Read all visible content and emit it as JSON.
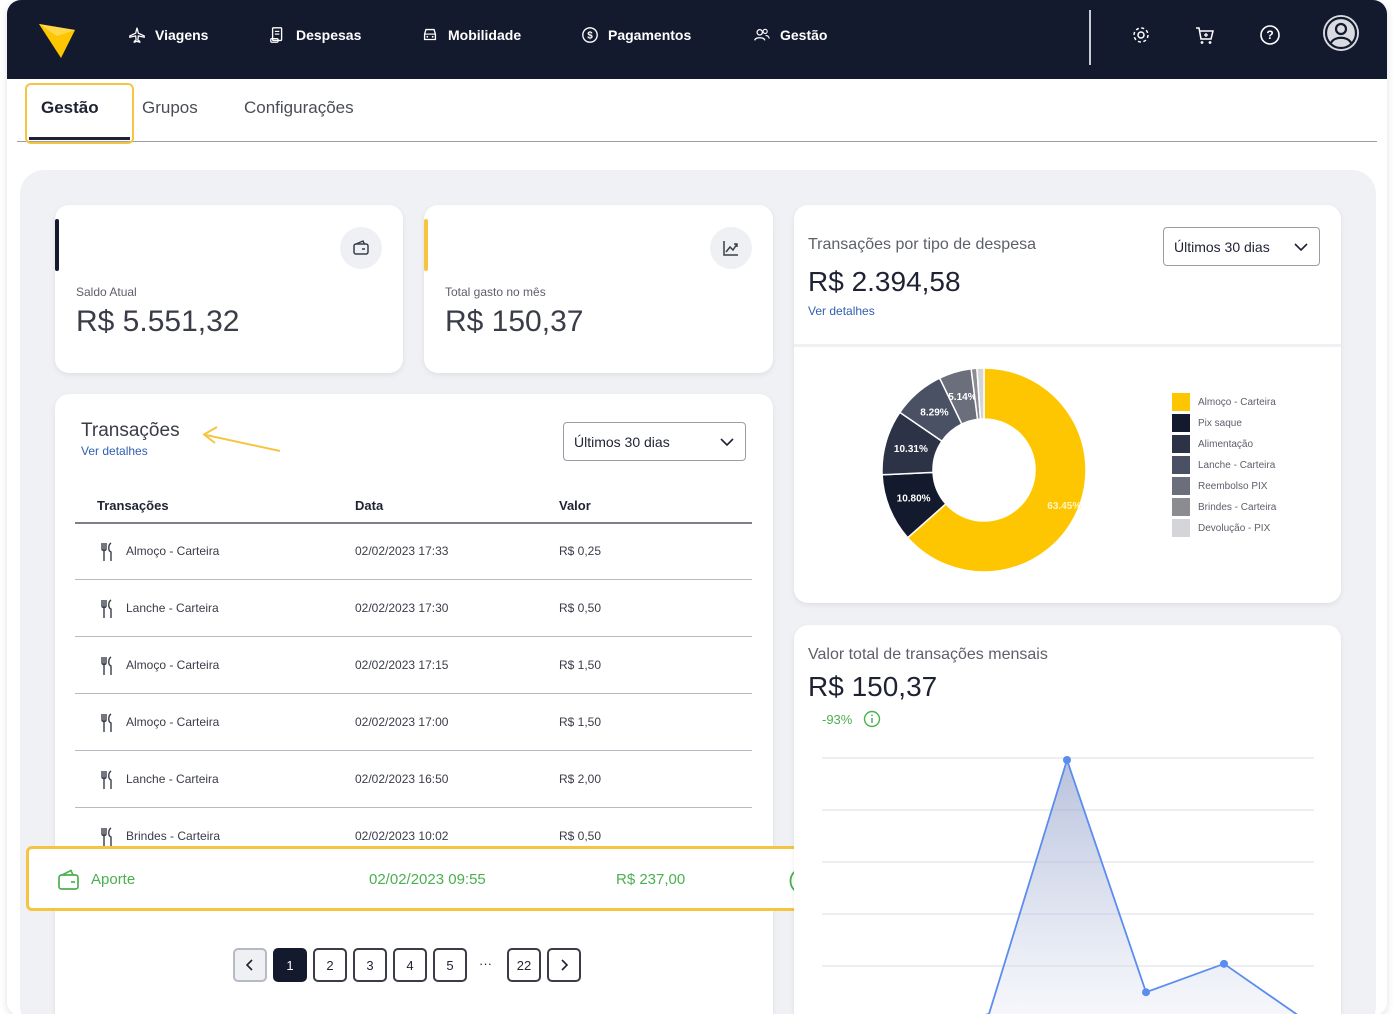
{
  "nav": {
    "items": [
      {
        "label": "Viagens",
        "icon": "plane-icon"
      },
      {
        "label": "Despesas",
        "icon": "receipt-icon"
      },
      {
        "label": "Mobilidade",
        "icon": "car-icon"
      },
      {
        "label": "Pagamentos",
        "icon": "dollar-icon"
      },
      {
        "label": "Gestão",
        "icon": "users-icon"
      }
    ],
    "right_icons": [
      "gear-icon",
      "cart-icon",
      "help-icon",
      "avatar-icon"
    ]
  },
  "tabs": [
    "Gestão",
    "Grupos",
    "Configurações"
  ],
  "kpis": [
    {
      "label": "Saldo Atual",
      "value": "R$ 5.551,32",
      "accent": "#141a2e",
      "icon": "wallet-icon"
    },
    {
      "label": "Total gasto no mês",
      "value": "R$ 150,37",
      "accent": "#f5c542",
      "icon": "trend-chart-icon"
    }
  ],
  "transactions": {
    "title": "Transações",
    "link": "Ver detalhes",
    "filter": "Últimos 30 dias",
    "columns": [
      "Transações",
      "Data",
      "Valor"
    ],
    "rows": [
      {
        "name": "Almoço - Carteira",
        "date": "02/02/2023 17:33",
        "value": "R$ 0,25"
      },
      {
        "name": "Lanche - Carteira",
        "date": "02/02/2023 17:30",
        "value": "R$ 0,50"
      },
      {
        "name": "Almoço - Carteira",
        "date": "02/02/2023 17:15",
        "value": "R$ 1,50"
      },
      {
        "name": "Almoço - Carteira",
        "date": "02/02/2023 17:00",
        "value": "R$ 1,50"
      },
      {
        "name": "Lanche - Carteira",
        "date": "02/02/2023 16:50",
        "value": "R$ 2,00"
      },
      {
        "name": "Brindes - Carteira",
        "date": "02/02/2023 10:02",
        "value": "R$ 0,50"
      }
    ],
    "highlight": {
      "name": "Aporte",
      "date": "02/02/2023 09:55",
      "value": "R$ 237,00"
    },
    "pager": {
      "pages": [
        "1",
        "2",
        "3",
        "4",
        "5"
      ],
      "ellipsis": "···",
      "last": "22",
      "current": "1"
    }
  },
  "expense_types": {
    "title": "Transações por tipo de despesa",
    "total": "R$ 2.394,58",
    "link": "Ver detalhes",
    "filter": "Últimos 30 dias"
  },
  "monthly": {
    "title": "Valor total de transações mensais",
    "total": "R$ 150,37",
    "change": "-93%",
    "accent": "#4caf50"
  },
  "colors": {
    "brand": "#f5c542",
    "navy": "#141a2e",
    "success": "#4caf50"
  },
  "chart_data": [
    {
      "type": "pie",
      "categories": [
        "Almoço - Carteira",
        "Pix saque",
        "Alimentação",
        "Lanche - Carteira",
        "Reembolso PIX",
        "Brindes - Carteira",
        "Devolução - PIX"
      ],
      "values": [
        63.45,
        10.8,
        10.31,
        8.29,
        5.14,
        0.9,
        1.11
      ],
      "data_labels": [
        "63.45%",
        "10.80%",
        "10.31%",
        "8.29%",
        "5.14%",
        "",
        ""
      ],
      "colors": [
        "#fec600",
        "#141a2e",
        "#2c3347",
        "#4a5164",
        "#6b6f7b",
        "#8a8c92",
        "#d4d5d8"
      ],
      "legend": "right"
    },
    {
      "type": "area",
      "values": [
        0,
        0.3,
        100,
        10,
        21,
        0
      ],
      "grid": true,
      "color": "#5b8def"
    }
  ]
}
